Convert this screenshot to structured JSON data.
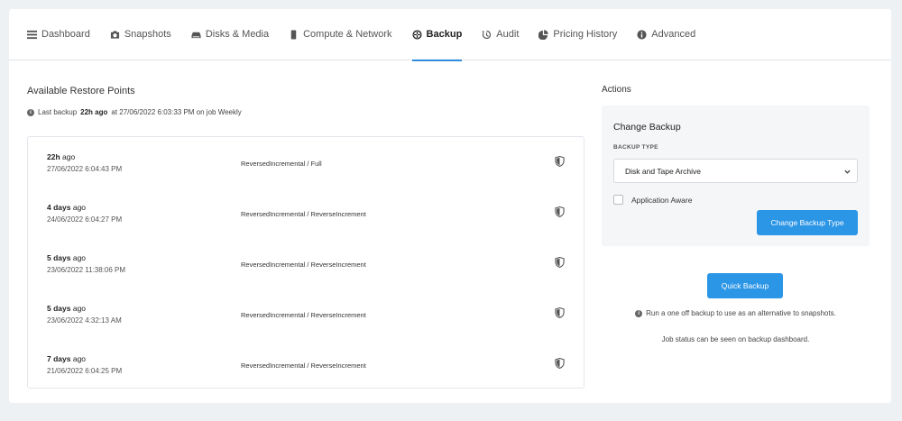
{
  "tabs": [
    {
      "label": "Dashboard",
      "icon": "dashboard-icon"
    },
    {
      "label": "Snapshots",
      "icon": "camera-icon"
    },
    {
      "label": "Disks & Media",
      "icon": "disk-icon"
    },
    {
      "label": "Compute & Network",
      "icon": "server-icon"
    },
    {
      "label": "Backup",
      "icon": "globe-icon",
      "active": true
    },
    {
      "label": "Audit",
      "icon": "history-icon"
    },
    {
      "label": "Pricing History",
      "icon": "pie-chart-icon"
    },
    {
      "label": "Advanced",
      "icon": "info-icon"
    }
  ],
  "restore": {
    "title": "Available Restore Points",
    "last_backup_prefix": "Last backup",
    "last_backup_age": "22h ago",
    "last_backup_suffix": "at 27/06/2022 6:03:33 PM on job Weekly",
    "points": [
      {
        "age_num": "22h",
        "age_unit": "ago",
        "date": "27/06/2022 6:04:43 PM",
        "type": "ReversedIncremental / Full"
      },
      {
        "age_num": "4 days",
        "age_unit": "ago",
        "date": "24/06/2022 6:04:27 PM",
        "type": "ReversedIncremental / ReverseIncrement"
      },
      {
        "age_num": "5 days",
        "age_unit": "ago",
        "date": "23/06/2022 11:38:06 PM",
        "type": "ReversedIncremental / ReverseIncrement"
      },
      {
        "age_num": "5 days",
        "age_unit": "ago",
        "date": "23/06/2022 4:32:13 AM",
        "type": "ReversedIncremental / ReverseIncrement"
      },
      {
        "age_num": "7 days",
        "age_unit": "ago",
        "date": "21/06/2022 6:04:25 PM",
        "type": "ReversedIncremental / ReverseIncrement"
      }
    ]
  },
  "actions": {
    "label": "Actions",
    "change_backup": {
      "title": "Change Backup",
      "field_label": "BACKUP TYPE",
      "selected": "Disk and Tape Archive",
      "checkbox_label": "Application Aware",
      "checkbox_checked": false,
      "button": "Change Backup Type"
    },
    "quick_backup_button": "Quick Backup",
    "info_text": "Run a one off backup to use as an alternative to snapshots.",
    "status_text": "Job status can be seen on backup dashboard."
  },
  "colors": {
    "accent": "#2b95e6",
    "tab_underline": "#2f8cdc"
  }
}
